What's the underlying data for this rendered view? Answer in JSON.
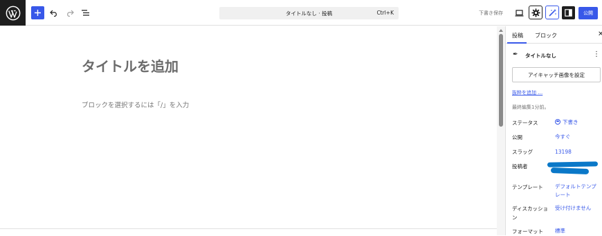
{
  "topbar": {
    "command_bar_title": "タイトルなし · 投稿",
    "command_bar_shortcut": "Ctrl+K",
    "save_draft_label": "下書き保存",
    "publish_label": "公開",
    "icons": [
      "wordpress-icon",
      "plus-icon",
      "undo-icon",
      "redo-icon",
      "list-view-icon",
      "desktop-preview-icon",
      "settings-gear-icon",
      "magic-wand-icon",
      "sidebar-toggle-icon"
    ]
  },
  "editor": {
    "title_placeholder": "タイトルを追加",
    "block_hint": "ブロックを選択するには「/」を入力"
  },
  "sidebar": {
    "tabs": [
      {
        "label": "投稿",
        "active": true
      },
      {
        "label": "ブロック",
        "active": false
      }
    ],
    "post_title": "タイトルなし",
    "featured_image_button": "アイキャッチ画像を設定",
    "excerpt_link": "抜粋を追加 …",
    "last_edited": "最終編集1分前。",
    "properties": [
      {
        "label": "ステータス",
        "value": "下書き"
      },
      {
        "label": "公開",
        "value": "今すぐ"
      },
      {
        "label": "スラッグ",
        "value": "13198"
      },
      {
        "label": "投稿者",
        "value": ""
      },
      {
        "label": "テンプレート",
        "value": "デフォルトテンプレート"
      },
      {
        "label": "ディスカッション",
        "value": "受け付けません"
      },
      {
        "label": "フォーマット",
        "value": "標準"
      }
    ]
  },
  "colors": {
    "accent": "#3858e9",
    "wp_logo_bg": "#1e1e1e",
    "redaction": "#0a78c8"
  }
}
